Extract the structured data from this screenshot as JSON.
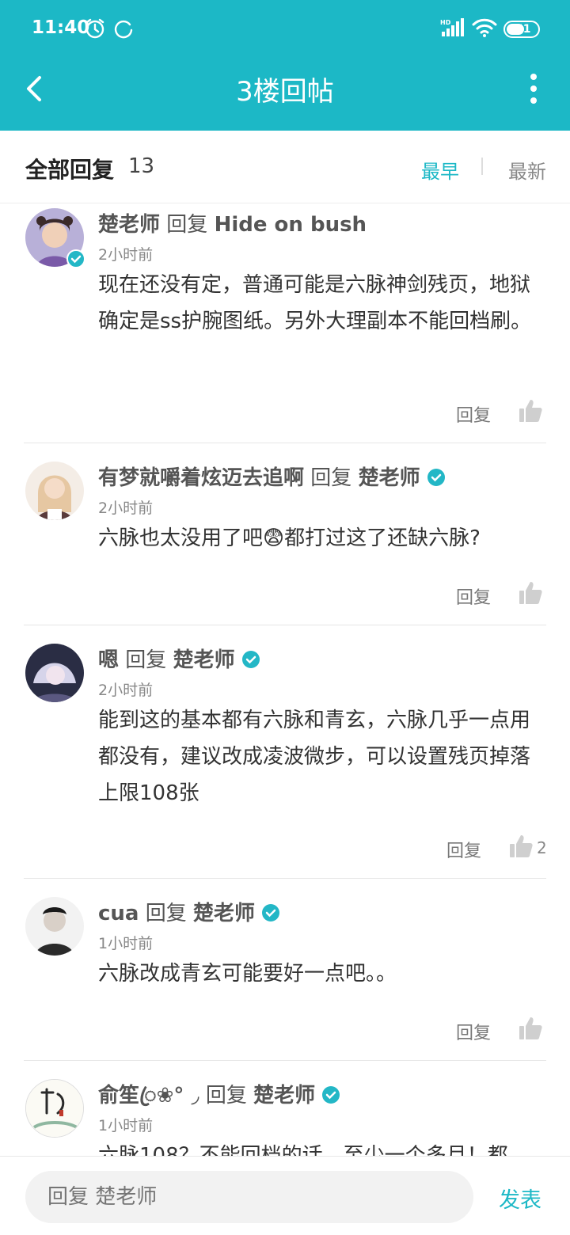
{
  "status": {
    "time": "11:40",
    "network": "HD",
    "battery": "51"
  },
  "nav": {
    "title": "3楼回帖"
  },
  "header": {
    "title": "全部回复",
    "count": "13",
    "sort_early": "最早",
    "sort_new": "最新"
  },
  "replies": [
    {
      "user": "楚老师",
      "reply_word": "回复",
      "target": "Hide on bush",
      "time": "2小时前",
      "text": "现在还没有定，普通可能是六脉神剑残页，地狱确定是ss护腕图纸。另外大理副本不能回档刷。",
      "action": "回复",
      "likes": ""
    },
    {
      "user": "有梦就嚼着炫迈去追啊",
      "reply_word": "回复",
      "target": "楚老师",
      "time": "2小时前",
      "text_before": "六脉也太没用了吧",
      "emoji": "😨",
      "text_after": "都打过这了还缺六脉?",
      "action": "回复",
      "likes": ""
    },
    {
      "user": "嗯",
      "reply_word": "回复",
      "target": "楚老师",
      "time": "2小时前",
      "text": "能到这的基本都有六脉和青玄，六脉几乎一点用都没有，建议改成凌波微步，可以设置残页掉落上限108张",
      "action": "回复",
      "likes": "2"
    },
    {
      "user": "cua",
      "reply_word": "回复",
      "target": "楚老师",
      "time": "1小时前",
      "text": "六脉改成青玄可能要好一点吧。。",
      "action": "回复",
      "likes": ""
    },
    {
      "user": "俞笙ꦿ❀° ◞",
      "reply_word": "回复",
      "target": "楚老师",
      "time": "1小时前",
      "text": "六脉108？不能回档的话，至少一个多月！都",
      "action": "回复",
      "likes": ""
    }
  ],
  "bottom": {
    "placeholder": "回复 楚老师",
    "send": "发表"
  },
  "colors": {
    "accent": "#1cb8c6",
    "badge": "#23b7c6"
  }
}
